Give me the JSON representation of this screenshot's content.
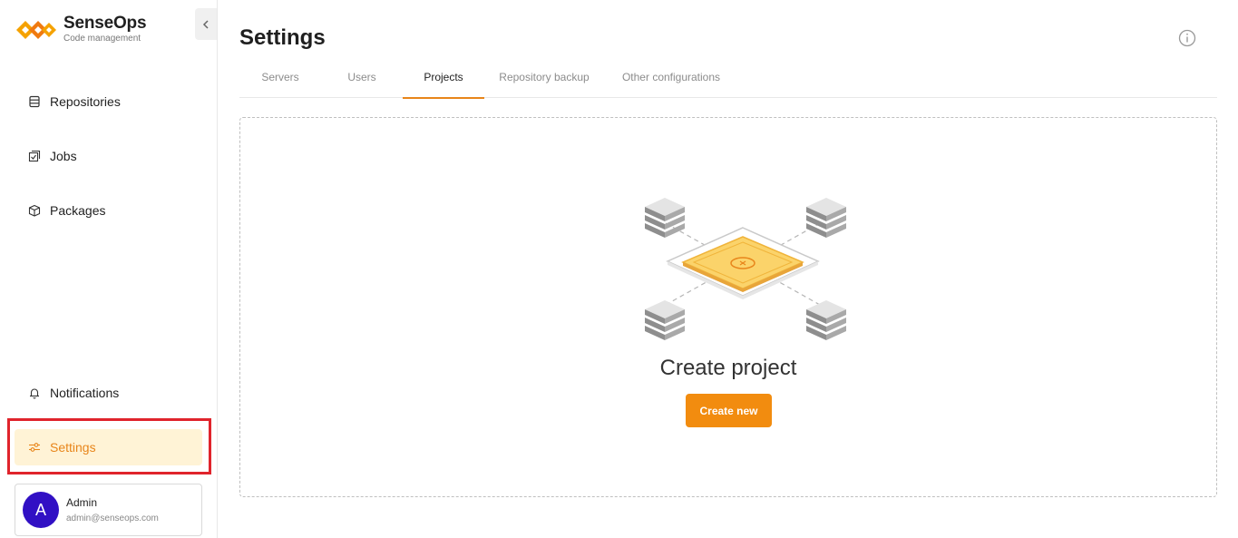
{
  "brand": {
    "name": "SenseOps",
    "subtitle": "Code management",
    "logo_icon": "senseops-logo-icon"
  },
  "sidebar": {
    "collapse_icon": "chevron-left-icon",
    "items": [
      {
        "label": "Repositories",
        "icon": "database-icon"
      },
      {
        "label": "Jobs",
        "icon": "jobs-icon"
      },
      {
        "label": "Packages",
        "icon": "package-icon"
      },
      {
        "label": "Notifications",
        "icon": "bell-icon"
      },
      {
        "label": "Settings",
        "icon": "sliders-icon",
        "active": true
      }
    ]
  },
  "user": {
    "initial": "A",
    "name": "Admin",
    "email": "admin@senseops.com"
  },
  "page": {
    "title": "Settings",
    "info_icon": "info-icon"
  },
  "tabs": [
    {
      "label": "Servers"
    },
    {
      "label": "Users"
    },
    {
      "label": "Projects",
      "active": true
    },
    {
      "label": "Repository backup"
    },
    {
      "label": "Other configurations"
    }
  ],
  "empty_state": {
    "title": "Create project",
    "button_label": "Create new",
    "illustration": "project-network-illustration"
  },
  "colors": {
    "accent": "#f28c0f",
    "active_bg": "#fff3d6",
    "highlight": "#e0242c",
    "avatar": "#3110c4"
  }
}
